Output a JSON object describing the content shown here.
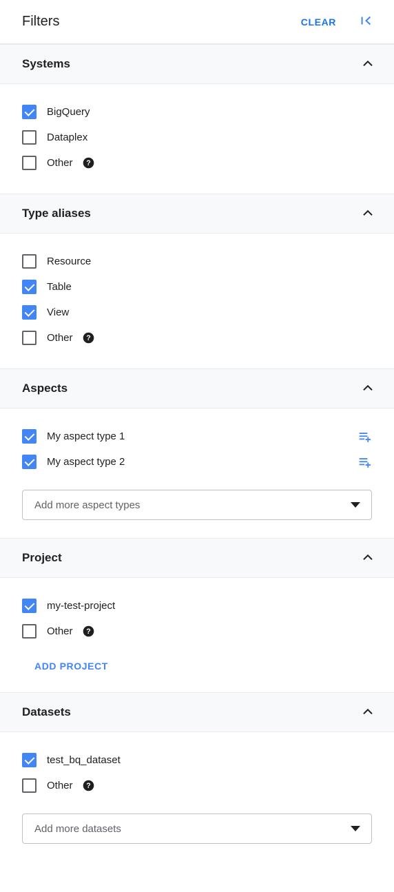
{
  "header": {
    "title": "Filters",
    "clear_label": "CLEAR",
    "collapse_icon": "first-page-icon"
  },
  "sections": [
    {
      "key": "systems",
      "title": "Systems",
      "expanded": true,
      "chevron_icon": "chevron-up-icon",
      "options": [
        {
          "label": "BigQuery",
          "checked": true,
          "help": false
        },
        {
          "label": "Dataplex",
          "checked": false,
          "help": false
        },
        {
          "label": "Other",
          "checked": false,
          "help": true
        }
      ]
    },
    {
      "key": "type_aliases",
      "title": "Type aliases",
      "expanded": true,
      "chevron_icon": "chevron-up-icon",
      "options": [
        {
          "label": "Resource",
          "checked": false,
          "help": false
        },
        {
          "label": "Table",
          "checked": true,
          "help": false
        },
        {
          "label": "View",
          "checked": true,
          "help": false
        },
        {
          "label": "Other",
          "checked": false,
          "help": true
        }
      ]
    },
    {
      "key": "aspects",
      "title": "Aspects",
      "expanded": true,
      "chevron_icon": "chevron-up-icon",
      "options": [
        {
          "label": "My aspect type 1",
          "checked": true,
          "help": false,
          "action_icon": "playlist-add-icon"
        },
        {
          "label": "My aspect type 2",
          "checked": true,
          "help": false,
          "action_icon": "playlist-add-icon"
        }
      ],
      "dropdown": {
        "placeholder": "Add more aspect types",
        "value": "",
        "caret_icon": "caret-down-icon"
      }
    },
    {
      "key": "project",
      "title": "Project",
      "expanded": true,
      "chevron_icon": "chevron-up-icon",
      "options": [
        {
          "label": "my-test-project",
          "checked": true,
          "help": false
        },
        {
          "label": "Other",
          "checked": false,
          "help": true
        }
      ],
      "text_button": "ADD PROJECT"
    },
    {
      "key": "datasets",
      "title": "Datasets",
      "expanded": true,
      "chevron_icon": "chevron-up-icon",
      "options": [
        {
          "label": "test_bq_dataset",
          "checked": true,
          "help": false
        },
        {
          "label": "Other",
          "checked": false,
          "help": true
        }
      ],
      "dropdown": {
        "placeholder": "Add more datasets",
        "value": "",
        "caret_icon": "caret-down-icon"
      }
    }
  ],
  "colors": {
    "accent_blue": "#1a73e8",
    "checkbox_blue": "#4285f4",
    "section_header_bg": "#f8f9fa",
    "border": "#e8eaed",
    "text_primary": "#202124",
    "text_secondary": "#5f6368"
  }
}
